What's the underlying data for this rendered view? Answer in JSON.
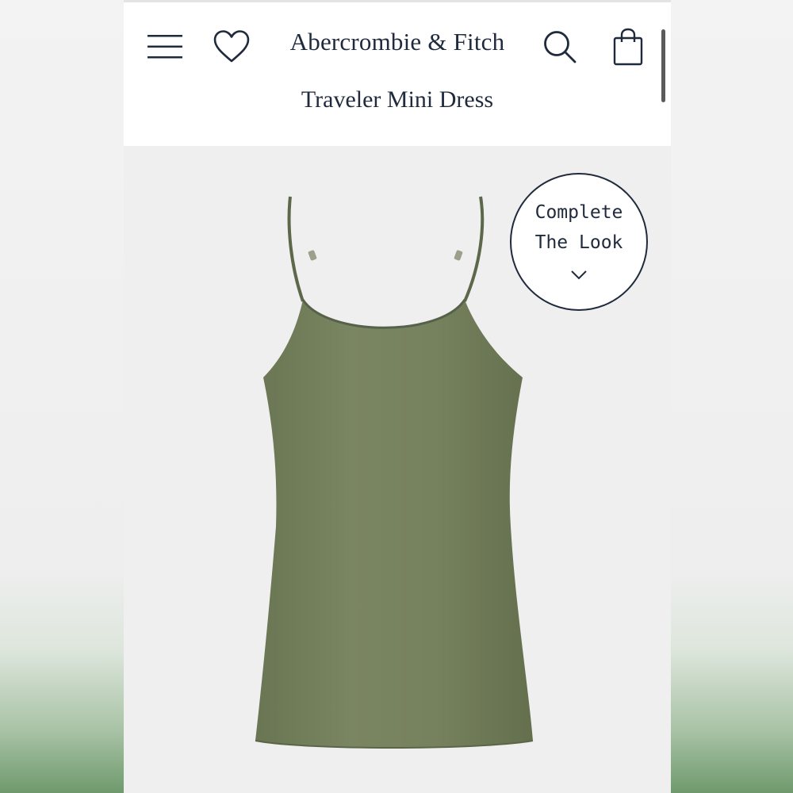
{
  "header": {
    "brand": "Abercrombie & Fitch",
    "product_title": "Traveler Mini Dress",
    "icons": {
      "menu": "hamburger-menu-icon",
      "wishlist": "heart-icon",
      "search": "search-icon",
      "bag": "shopping-bag-icon"
    }
  },
  "product": {
    "image": "olive green mini dress",
    "color": "#6f7b58",
    "complete_look": {
      "line1": "Complete",
      "line2": "The Look",
      "icon": "chevron-down-icon"
    }
  },
  "colors": {
    "text": "#1f2a3c",
    "header_bg": "#ffffff",
    "image_bg": "#efefef"
  }
}
